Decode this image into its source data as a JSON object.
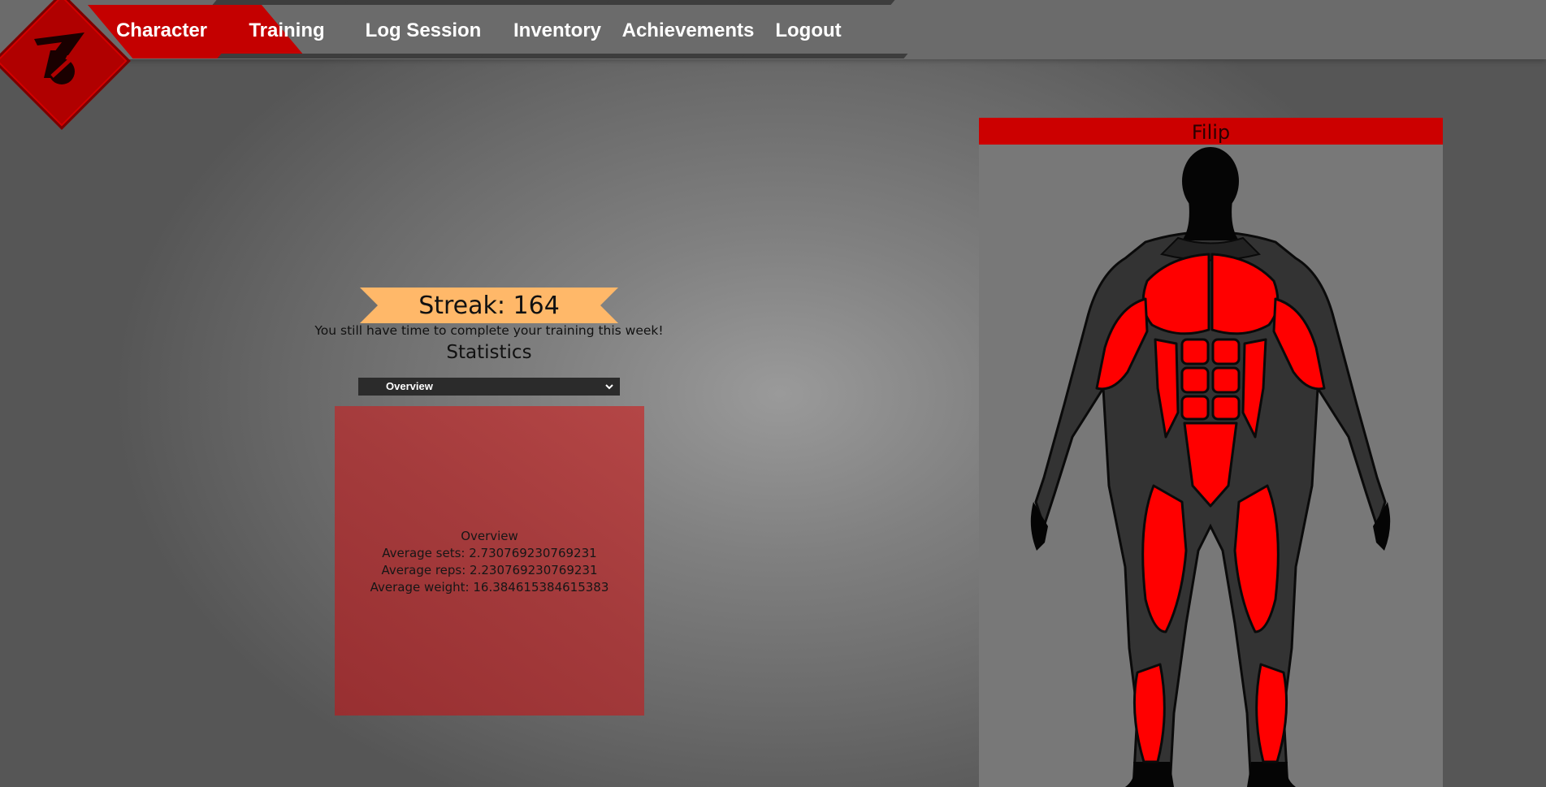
{
  "nav": {
    "items": [
      {
        "label": "Character",
        "active": true
      },
      {
        "label": "Training",
        "active": false
      },
      {
        "label": "Log Session",
        "active": false
      },
      {
        "label": "Inventory",
        "active": false
      },
      {
        "label": "Achievements",
        "active": false
      },
      {
        "label": "Logout",
        "active": false
      }
    ]
  },
  "streak": {
    "label": "Streak: 164",
    "message": "You still have time to complete your training this week!"
  },
  "statistics": {
    "heading": "Statistics",
    "selected": "Overview",
    "panel_title": "Overview",
    "lines": [
      "Average sets: 2.730769230769231",
      "Average reps: 2.230769230769231",
      "Average weight: 16.384615384615383"
    ]
  },
  "character": {
    "name": "Filip"
  },
  "colors": {
    "brand_red": "#cc0000",
    "muscle_red": "#ff0000",
    "banner_orange": "#ffb869",
    "nav_bg": "#6b6b6b"
  },
  "icons": {
    "logo": "logo-icon",
    "dropdown": "chevron-down-icon"
  }
}
